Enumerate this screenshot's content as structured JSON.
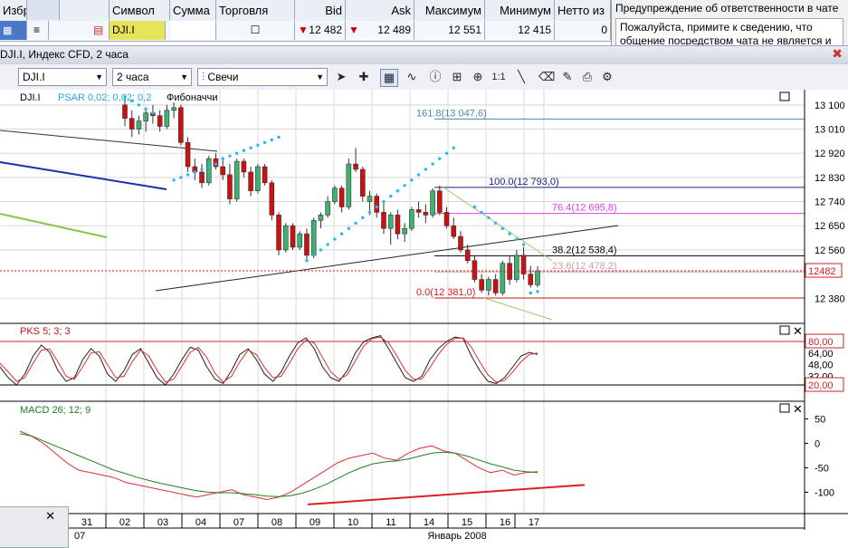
{
  "quote_table": {
    "fav_label": "Избр",
    "headers": [
      "Символ",
      "Сумма",
      "Торговля",
      "Bid",
      "",
      "Ask",
      "Максимум",
      "Минимум",
      "Нетто из"
    ],
    "row": {
      "symbol": "DJI.I",
      "amount": "",
      "bid": "12 482",
      "ask": "12 489",
      "high": "12 551",
      "low": "12 415",
      "net": "0"
    }
  },
  "chat": {
    "title": "Предупреждение об ответственности в чате",
    "text": "Пожалуйста, примите к сведению, что общение посредством чата не является и не должно"
  },
  "window": {
    "title": "DJI.I, Индекс CFD, 2 часа"
  },
  "toolbar": {
    "symbol": "DJI.I",
    "period": "2 часа",
    "chart_type": "Свечи"
  },
  "chart_data": [
    {
      "type": "candlestick",
      "legend": {
        "symbol": "DJI.I",
        "psar": "PSAR 0,02; 0,02; 0,2",
        "fib": "Фибоначчи"
      },
      "ylim": [
        12300,
        13150
      ],
      "y_ticks": [
        "13 100",
        "13 010",
        "12 920",
        "12 830",
        "12 740",
        "12 650",
        "12 560",
        "12 380"
      ],
      "current_price_label": "12482",
      "current_price": 12482,
      "fib_levels": [
        {
          "label": "161.8(13 047,6)",
          "value": 13047.6,
          "color": "#4a8aa8"
        },
        {
          "label": "100.0(12 793,0)",
          "value": 12793,
          "color": "#1a237e"
        },
        {
          "label": "76.4(12 695,8)",
          "value": 12695.8,
          "color": "#e040e0"
        },
        {
          "label": "38.2(12 538,4)",
          "value": 12538.4,
          "color": "#000000"
        },
        {
          "label": "23.6(12 478,2)",
          "value": 12478.2,
          "color": "#c8a0a0"
        },
        {
          "label": "0.0(12 381,0)",
          "value": 12381,
          "color": "#d02020"
        }
      ],
      "candles": [
        [
          13100,
          13130,
          13020,
          13050
        ],
        [
          13050,
          13080,
          12980,
          13010
        ],
        [
          13010,
          13060,
          12990,
          13040
        ],
        [
          13040,
          13090,
          13000,
          13070
        ],
        [
          13070,
          13100,
          13030,
          13060
        ],
        [
          13060,
          13080,
          13000,
          13020
        ],
        [
          13020,
          13100,
          13010,
          13080
        ],
        [
          13080,
          13110,
          13050,
          13090
        ],
        [
          13090,
          13100,
          12950,
          12960
        ],
        [
          12960,
          12980,
          12850,
          12870
        ],
        [
          12870,
          12900,
          12820,
          12850
        ],
        [
          12850,
          12880,
          12790,
          12810
        ],
        [
          12810,
          12910,
          12800,
          12900
        ],
        [
          12900,
          12920,
          12860,
          12870
        ],
        [
          12870,
          12900,
          12820,
          12840
        ],
        [
          12840,
          12880,
          12730,
          12750
        ],
        [
          12750,
          12900,
          12740,
          12890
        ],
        [
          12890,
          12900,
          12830,
          12850
        ],
        [
          12850,
          12870,
          12760,
          12780
        ],
        [
          12780,
          12880,
          12770,
          12870
        ],
        [
          12870,
          12880,
          12800,
          12810
        ],
        [
          12810,
          12820,
          12670,
          12690
        ],
        [
          12690,
          12700,
          12540,
          12560
        ],
        [
          12560,
          12660,
          12550,
          12650
        ],
        [
          12650,
          12660,
          12560,
          12570
        ],
        [
          12570,
          12630,
          12560,
          12620
        ],
        [
          12620,
          12640,
          12520,
          12540
        ],
        [
          12540,
          12680,
          12530,
          12670
        ],
        [
          12670,
          12700,
          12640,
          12690
        ],
        [
          12690,
          12760,
          12680,
          12740
        ],
        [
          12740,
          12800,
          12730,
          12790
        ],
        [
          12790,
          12800,
          12700,
          12720
        ],
        [
          12720,
          12900,
          12710,
          12880
        ],
        [
          12880,
          12940,
          12850,
          12860
        ],
        [
          12860,
          12870,
          12740,
          12760
        ],
        [
          12740,
          12780,
          12690,
          12760
        ],
        [
          12760,
          12770,
          12680,
          12700
        ],
        [
          12700,
          12740,
          12620,
          12640
        ],
        [
          12640,
          12700,
          12580,
          12690
        ],
        [
          12690,
          12710,
          12600,
          12620
        ],
        [
          12620,
          12660,
          12590,
          12640
        ],
        [
          12640,
          12720,
          12630,
          12710
        ],
        [
          12710,
          12740,
          12680,
          12700
        ],
        [
          12700,
          12730,
          12660,
          12690
        ],
        [
          12690,
          12790,
          12680,
          12780
        ],
        [
          12780,
          12800,
          12690,
          12700
        ],
        [
          12700,
          12720,
          12640,
          12650
        ],
        [
          12650,
          12680,
          12600,
          12610
        ],
        [
          12610,
          12630,
          12550,
          12560
        ],
        [
          12560,
          12580,
          12510,
          12520
        ],
        [
          12520,
          12540,
          12440,
          12450
        ],
        [
          12450,
          12470,
          12400,
          12410
        ],
        [
          12410,
          12460,
          12390,
          12450
        ],
        [
          12450,
          12470,
          12390,
          12400
        ],
        [
          12400,
          12520,
          12390,
          12510
        ],
        [
          12510,
          12540,
          12430,
          12450
        ],
        [
          12450,
          12560,
          12440,
          12540
        ],
        [
          12540,
          12570,
          12450,
          12470
        ],
        [
          12470,
          12500,
          12420,
          12430
        ],
        [
          12430,
          12500,
          12420,
          12482
        ]
      ],
      "psar": [
        13130,
        13115,
        13100,
        13085,
        13070,
        null,
        null,
        12820,
        12830,
        12840,
        12850,
        12860,
        12870,
        12880,
        12900,
        12910,
        12920,
        12930,
        12940,
        12950,
        12960,
        12970,
        12980,
        null,
        null,
        null,
        12520,
        12540,
        12560,
        12580,
        12600,
        12620,
        12640,
        12660,
        12680,
        12700,
        12720,
        12740,
        12760,
        12780,
        12800,
        12820,
        12840,
        12860,
        12880,
        12900,
        12920,
        12940,
        null,
        null,
        12720,
        12700,
        12680,
        12660,
        12640,
        12620,
        12600,
        12580,
        12400,
        12405
      ]
    },
    {
      "type": "line",
      "indicator": "PKS 5; 3; 3",
      "ylim": [
        0,
        100
      ],
      "y_ticks": [
        "80,00",
        "64,00",
        "48,00",
        "32,00",
        "20,00"
      ],
      "levels": [
        80,
        20
      ],
      "series": [
        {
          "name": "",
          "color": "#202020",
          "values": [
            45,
            30,
            20,
            35,
            60,
            75,
            65,
            40,
            25,
            30,
            55,
            70,
            60,
            35,
            25,
            40,
            62,
            70,
            50,
            30,
            20,
            35,
            55,
            72,
            68,
            45,
            28,
            22,
            40,
            62,
            70,
            55,
            35,
            25,
            38,
            60,
            78,
            85,
            70,
            45,
            30,
            25,
            40,
            65,
            80,
            85,
            88,
            70,
            50,
            30,
            25,
            32,
            55,
            70,
            80,
            86,
            84,
            60,
            40,
            25,
            22,
            30,
            45,
            60,
            65,
            62
          ]
        },
        {
          "name": "",
          "color": "#e03030",
          "values": [
            50,
            38,
            25,
            30,
            50,
            68,
            70,
            52,
            32,
            28,
            45,
            64,
            66,
            48,
            30,
            32,
            52,
            68,
            60,
            40,
            24,
            28,
            46,
            65,
            72,
            58,
            36,
            24,
            32,
            52,
            68,
            62,
            44,
            30,
            32,
            50,
            70,
            82,
            78,
            58,
            38,
            28,
            34,
            54,
            74,
            84,
            86,
            78,
            60,
            40,
            28,
            28,
            44,
            62,
            76,
            84,
            85,
            72,
            52,
            34,
            24,
            26,
            38,
            52,
            62,
            64
          ]
        }
      ]
    },
    {
      "type": "line",
      "indicator": "MACD 26; 12; 9",
      "ylim": [
        -140,
        75
      ],
      "y_ticks": [
        "50",
        "0",
        "-50",
        "-100"
      ],
      "series": [
        {
          "name": "",
          "color": "#e03030",
          "values": [
            25,
            15,
            0,
            -20,
            -40,
            -55,
            -60,
            -65,
            -70,
            -80,
            -85,
            -90,
            -95,
            -100,
            -105,
            -110,
            -105,
            -100,
            -95,
            -105,
            -110,
            -115,
            -110,
            -100,
            -85,
            -70,
            -55,
            -40,
            -30,
            -25,
            -20,
            -30,
            -35,
            -20,
            -10,
            -5,
            -15,
            -20,
            -35,
            -50,
            -60,
            -55,
            -65,
            -60,
            -58
          ]
        },
        {
          "name": "",
          "color": "#208020",
          "values": [
            20,
            15,
            5,
            -5,
            -15,
            -25,
            -35,
            -45,
            -55,
            -62,
            -70,
            -76,
            -82,
            -87,
            -92,
            -97,
            -100,
            -101,
            -101,
            -103,
            -105,
            -108,
            -109,
            -107,
            -102,
            -94,
            -84,
            -72,
            -60,
            -50,
            -42,
            -38,
            -36,
            -32,
            -26,
            -20,
            -18,
            -20,
            -26,
            -34,
            -42,
            -48,
            -55,
            -58,
            -60
          ]
        }
      ],
      "trendline_color": "#e02020"
    }
  ],
  "time_axis": {
    "labels": [
      "31",
      "02",
      "03",
      "04",
      "07",
      "08",
      "09",
      "10",
      "11",
      "14",
      "15",
      "16",
      "17"
    ],
    "month_label": "Январь 2008",
    "left_label": "07"
  },
  "colors": {
    "up": "#3cb371",
    "down": "#cc1111",
    "psar": "#29b6f6",
    "grid": "#d8d8d8"
  }
}
